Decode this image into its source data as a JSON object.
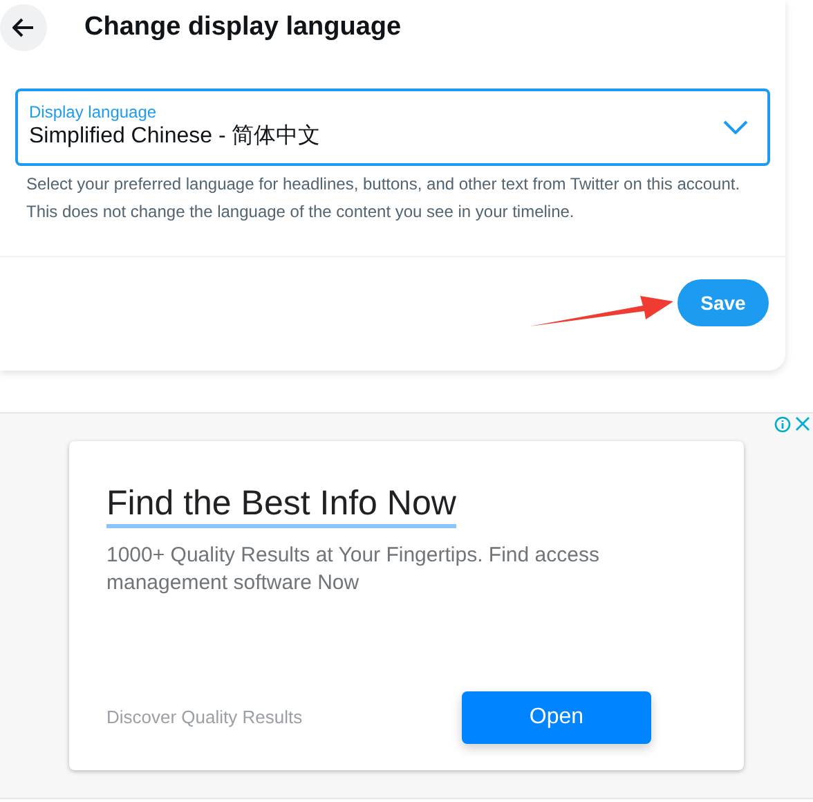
{
  "header": {
    "title": "Change display language"
  },
  "language_select": {
    "label": "Display language",
    "value": "Simplified Chinese - 简体中文",
    "focused": true
  },
  "help_text": "Select your preferred language for headlines, buttons, and other text from Twitter on this account. This does not change the language of the content you see in your timeline.",
  "save_button": "Save",
  "ad": {
    "headline": "Find the Best Info Now",
    "body": "1000+ Quality Results at Your Fingertips. Find access management software Now",
    "footer": "Discover Quality Results",
    "button": "Open"
  }
}
